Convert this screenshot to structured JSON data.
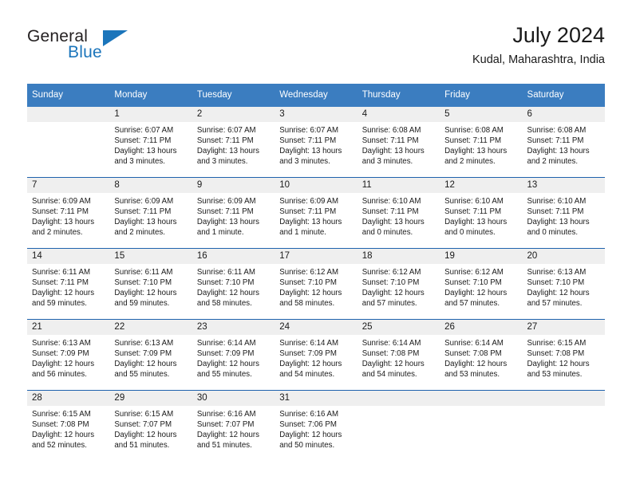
{
  "brand": {
    "name_top": "General",
    "name_bottom": "Blue",
    "triangle_icon": "triangle-icon",
    "colors": {
      "blue": "#1b75bb",
      "dark": "#231f20"
    }
  },
  "header": {
    "title": "July 2024",
    "subtitle": "Kudal, Maharashtra, India"
  },
  "theme": {
    "header_blue": "#3b7dc0",
    "divider_blue": "#1f62ad",
    "daynum_bg": "#efefef"
  },
  "calendar": {
    "weekday_headers": [
      "Sunday",
      "Monday",
      "Tuesday",
      "Wednesday",
      "Thursday",
      "Friday",
      "Saturday"
    ],
    "weeks": [
      {
        "days": [
          {
            "num": "",
            "sunrise": "",
            "sunset": "",
            "daylight_line1": "",
            "daylight_line2": ""
          },
          {
            "num": "1",
            "sunrise": "Sunrise: 6:07 AM",
            "sunset": "Sunset: 7:11 PM",
            "daylight_line1": "Daylight: 13 hours",
            "daylight_line2": "and 3 minutes."
          },
          {
            "num": "2",
            "sunrise": "Sunrise: 6:07 AM",
            "sunset": "Sunset: 7:11 PM",
            "daylight_line1": "Daylight: 13 hours",
            "daylight_line2": "and 3 minutes."
          },
          {
            "num": "3",
            "sunrise": "Sunrise: 6:07 AM",
            "sunset": "Sunset: 7:11 PM",
            "daylight_line1": "Daylight: 13 hours",
            "daylight_line2": "and 3 minutes."
          },
          {
            "num": "4",
            "sunrise": "Sunrise: 6:08 AM",
            "sunset": "Sunset: 7:11 PM",
            "daylight_line1": "Daylight: 13 hours",
            "daylight_line2": "and 3 minutes."
          },
          {
            "num": "5",
            "sunrise": "Sunrise: 6:08 AM",
            "sunset": "Sunset: 7:11 PM",
            "daylight_line1": "Daylight: 13 hours",
            "daylight_line2": "and 2 minutes."
          },
          {
            "num": "6",
            "sunrise": "Sunrise: 6:08 AM",
            "sunset": "Sunset: 7:11 PM",
            "daylight_line1": "Daylight: 13 hours",
            "daylight_line2": "and 2 minutes."
          }
        ]
      },
      {
        "days": [
          {
            "num": "7",
            "sunrise": "Sunrise: 6:09 AM",
            "sunset": "Sunset: 7:11 PM",
            "daylight_line1": "Daylight: 13 hours",
            "daylight_line2": "and 2 minutes."
          },
          {
            "num": "8",
            "sunrise": "Sunrise: 6:09 AM",
            "sunset": "Sunset: 7:11 PM",
            "daylight_line1": "Daylight: 13 hours",
            "daylight_line2": "and 2 minutes."
          },
          {
            "num": "9",
            "sunrise": "Sunrise: 6:09 AM",
            "sunset": "Sunset: 7:11 PM",
            "daylight_line1": "Daylight: 13 hours",
            "daylight_line2": "and 1 minute."
          },
          {
            "num": "10",
            "sunrise": "Sunrise: 6:09 AM",
            "sunset": "Sunset: 7:11 PM",
            "daylight_line1": "Daylight: 13 hours",
            "daylight_line2": "and 1 minute."
          },
          {
            "num": "11",
            "sunrise": "Sunrise: 6:10 AM",
            "sunset": "Sunset: 7:11 PM",
            "daylight_line1": "Daylight: 13 hours",
            "daylight_line2": "and 0 minutes."
          },
          {
            "num": "12",
            "sunrise": "Sunrise: 6:10 AM",
            "sunset": "Sunset: 7:11 PM",
            "daylight_line1": "Daylight: 13 hours",
            "daylight_line2": "and 0 minutes."
          },
          {
            "num": "13",
            "sunrise": "Sunrise: 6:10 AM",
            "sunset": "Sunset: 7:11 PM",
            "daylight_line1": "Daylight: 13 hours",
            "daylight_line2": "and 0 minutes."
          }
        ]
      },
      {
        "days": [
          {
            "num": "14",
            "sunrise": "Sunrise: 6:11 AM",
            "sunset": "Sunset: 7:11 PM",
            "daylight_line1": "Daylight: 12 hours",
            "daylight_line2": "and 59 minutes."
          },
          {
            "num": "15",
            "sunrise": "Sunrise: 6:11 AM",
            "sunset": "Sunset: 7:10 PM",
            "daylight_line1": "Daylight: 12 hours",
            "daylight_line2": "and 59 minutes."
          },
          {
            "num": "16",
            "sunrise": "Sunrise: 6:11 AM",
            "sunset": "Sunset: 7:10 PM",
            "daylight_line1": "Daylight: 12 hours",
            "daylight_line2": "and 58 minutes."
          },
          {
            "num": "17",
            "sunrise": "Sunrise: 6:12 AM",
            "sunset": "Sunset: 7:10 PM",
            "daylight_line1": "Daylight: 12 hours",
            "daylight_line2": "and 58 minutes."
          },
          {
            "num": "18",
            "sunrise": "Sunrise: 6:12 AM",
            "sunset": "Sunset: 7:10 PM",
            "daylight_line1": "Daylight: 12 hours",
            "daylight_line2": "and 57 minutes."
          },
          {
            "num": "19",
            "sunrise": "Sunrise: 6:12 AM",
            "sunset": "Sunset: 7:10 PM",
            "daylight_line1": "Daylight: 12 hours",
            "daylight_line2": "and 57 minutes."
          },
          {
            "num": "20",
            "sunrise": "Sunrise: 6:13 AM",
            "sunset": "Sunset: 7:10 PM",
            "daylight_line1": "Daylight: 12 hours",
            "daylight_line2": "and 57 minutes."
          }
        ]
      },
      {
        "days": [
          {
            "num": "21",
            "sunrise": "Sunrise: 6:13 AM",
            "sunset": "Sunset: 7:09 PM",
            "daylight_line1": "Daylight: 12 hours",
            "daylight_line2": "and 56 minutes."
          },
          {
            "num": "22",
            "sunrise": "Sunrise: 6:13 AM",
            "sunset": "Sunset: 7:09 PM",
            "daylight_line1": "Daylight: 12 hours",
            "daylight_line2": "and 55 minutes."
          },
          {
            "num": "23",
            "sunrise": "Sunrise: 6:14 AM",
            "sunset": "Sunset: 7:09 PM",
            "daylight_line1": "Daylight: 12 hours",
            "daylight_line2": "and 55 minutes."
          },
          {
            "num": "24",
            "sunrise": "Sunrise: 6:14 AM",
            "sunset": "Sunset: 7:09 PM",
            "daylight_line1": "Daylight: 12 hours",
            "daylight_line2": "and 54 minutes."
          },
          {
            "num": "25",
            "sunrise": "Sunrise: 6:14 AM",
            "sunset": "Sunset: 7:08 PM",
            "daylight_line1": "Daylight: 12 hours",
            "daylight_line2": "and 54 minutes."
          },
          {
            "num": "26",
            "sunrise": "Sunrise: 6:14 AM",
            "sunset": "Sunset: 7:08 PM",
            "daylight_line1": "Daylight: 12 hours",
            "daylight_line2": "and 53 minutes."
          },
          {
            "num": "27",
            "sunrise": "Sunrise: 6:15 AM",
            "sunset": "Sunset: 7:08 PM",
            "daylight_line1": "Daylight: 12 hours",
            "daylight_line2": "and 53 minutes."
          }
        ]
      },
      {
        "days": [
          {
            "num": "28",
            "sunrise": "Sunrise: 6:15 AM",
            "sunset": "Sunset: 7:08 PM",
            "daylight_line1": "Daylight: 12 hours",
            "daylight_line2": "and 52 minutes."
          },
          {
            "num": "29",
            "sunrise": "Sunrise: 6:15 AM",
            "sunset": "Sunset: 7:07 PM",
            "daylight_line1": "Daylight: 12 hours",
            "daylight_line2": "and 51 minutes."
          },
          {
            "num": "30",
            "sunrise": "Sunrise: 6:16 AM",
            "sunset": "Sunset: 7:07 PM",
            "daylight_line1": "Daylight: 12 hours",
            "daylight_line2": "and 51 minutes."
          },
          {
            "num": "31",
            "sunrise": "Sunrise: 6:16 AM",
            "sunset": "Sunset: 7:06 PM",
            "daylight_line1": "Daylight: 12 hours",
            "daylight_line2": "and 50 minutes."
          },
          {
            "num": "",
            "sunrise": "",
            "sunset": "",
            "daylight_line1": "",
            "daylight_line2": ""
          },
          {
            "num": "",
            "sunrise": "",
            "sunset": "",
            "daylight_line1": "",
            "daylight_line2": ""
          },
          {
            "num": "",
            "sunrise": "",
            "sunset": "",
            "daylight_line1": "",
            "daylight_line2": ""
          }
        ]
      }
    ]
  }
}
